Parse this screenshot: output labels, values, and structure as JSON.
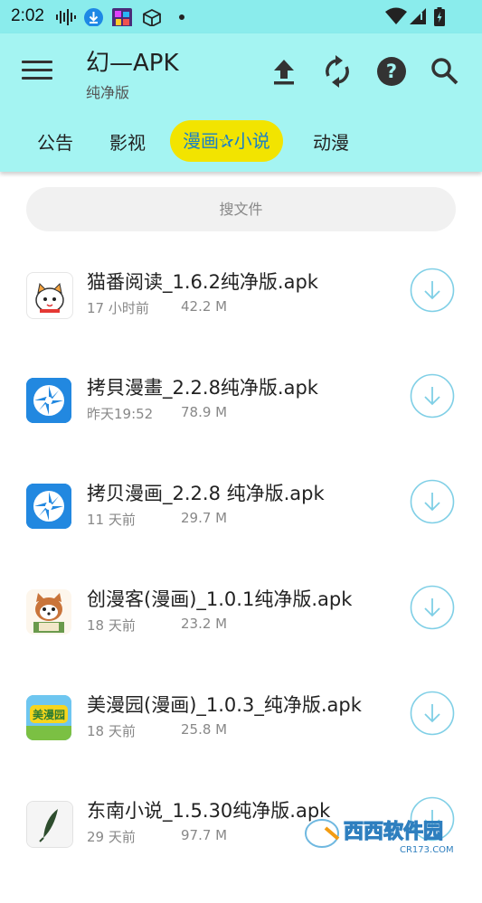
{
  "status_bar": {
    "time": "2:02"
  },
  "app_bar": {
    "title": "幻—APK",
    "subtitle": "纯净版",
    "actions": [
      "upload-icon",
      "refresh-icon",
      "help-icon",
      "search-icon"
    ]
  },
  "tabs": [
    {
      "label": "公告",
      "active": false
    },
    {
      "label": "影视",
      "active": false
    },
    {
      "label": "漫画✰小说",
      "active": true
    },
    {
      "label": "动漫",
      "active": false
    }
  ],
  "search": {
    "placeholder": "搜文件"
  },
  "files": [
    {
      "name": "猫番阅读_1.6.2纯净版.apk",
      "time": "17 小时前",
      "size": "42.2 M",
      "icon": "maofan-app-icon"
    },
    {
      "name": "拷貝漫畫_2.2.8纯净版.apk",
      "time": "昨天19:52",
      "size": "78.9 M",
      "icon": "kaobei-app-icon"
    },
    {
      "name": "拷贝漫画_2.2.8 纯净版.apk",
      "time": "11 天前",
      "size": "29.7 M",
      "icon": "kaobei-app-icon"
    },
    {
      "name": "创漫客(漫画)_1.0.1纯净版.apk",
      "time": "18 天前",
      "size": "23.2 M",
      "icon": "chuangmanke-app-icon"
    },
    {
      "name": "美漫园(漫画)_1.0.3_纯净版.apk",
      "time": "18 天前",
      "size": "25.8 M",
      "icon": "meimanyuan-app-icon"
    },
    {
      "name": "东南小说_1.5.30纯净版.apk",
      "time": "29 天前",
      "size": "97.7 M",
      "icon": "dongnan-app-icon"
    }
  ],
  "watermark": {
    "text": "西西软件园",
    "sub": "CR173.COM"
  },
  "colors": {
    "appbar": "#a4f4f2",
    "active_tab": "#f2e400",
    "accent": "#1a80c8",
    "download": "#7fcfe6"
  }
}
